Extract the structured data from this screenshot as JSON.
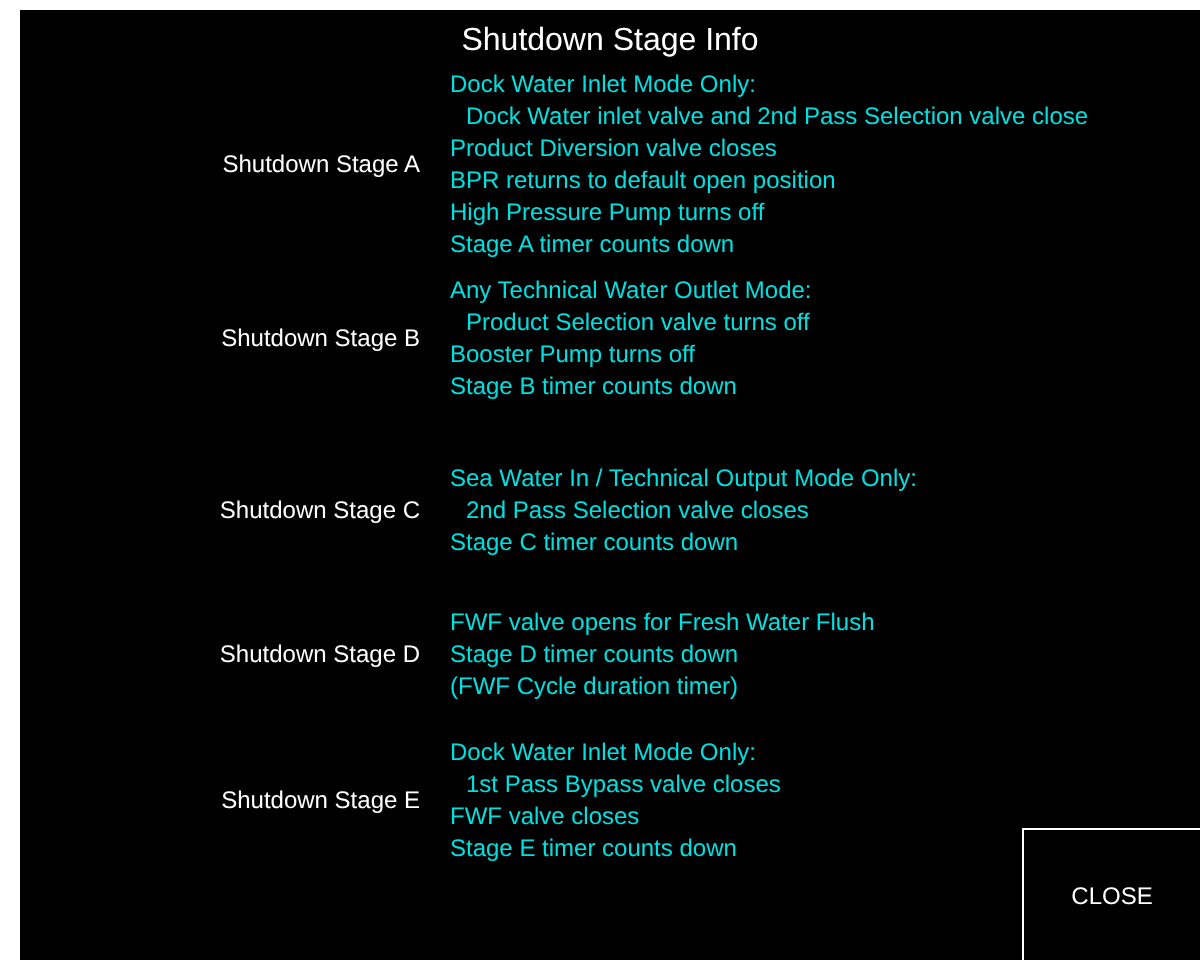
{
  "title": "Shutdown Stage Info",
  "stages": [
    {
      "label": "Shutdown Stage A",
      "lines": [
        {
          "text": "Dock Water Inlet Mode Only:",
          "indent": false
        },
        {
          "text": "Dock Water inlet valve and 2nd Pass Selection valve close",
          "indent": true
        },
        {
          "text": "Product Diversion valve closes",
          "indent": false
        },
        {
          "text": "BPR returns to default open position",
          "indent": false
        },
        {
          "text": "High Pressure Pump turns off",
          "indent": false
        },
        {
          "text": "Stage A timer counts down",
          "indent": false
        }
      ]
    },
    {
      "label": "Shutdown Stage B",
      "lines": [
        {
          "text": "Any Technical Water Outlet Mode:",
          "indent": false
        },
        {
          "text": "Product Selection valve turns off",
          "indent": true
        },
        {
          "text": "Booster Pump turns off",
          "indent": false
        },
        {
          "text": "Stage B timer counts down",
          "indent": false
        }
      ]
    },
    {
      "label": "Shutdown Stage C",
      "lines": [
        {
          "text": "Sea Water In / Technical Output Mode Only:",
          "indent": false
        },
        {
          "text": "2nd Pass Selection valve closes",
          "indent": true
        },
        {
          "text": "Stage C timer counts down",
          "indent": false
        }
      ]
    },
    {
      "label": "Shutdown Stage D",
      "lines": [
        {
          "text": "FWF valve opens for Fresh Water Flush",
          "indent": false
        },
        {
          "text": "Stage D timer counts down",
          "indent": false
        },
        {
          "text": "(FWF Cycle duration timer)",
          "indent": false
        }
      ]
    },
    {
      "label": "Shutdown Stage E",
      "lines": [
        {
          "text": "Dock Water Inlet Mode Only:",
          "indent": false
        },
        {
          "text": "1st Pass Bypass valve closes",
          "indent": true
        },
        {
          "text": "FWF valve closes",
          "indent": false
        },
        {
          "text": "Stage E timer counts down",
          "indent": false
        }
      ]
    }
  ],
  "close_button": "CLOSE"
}
